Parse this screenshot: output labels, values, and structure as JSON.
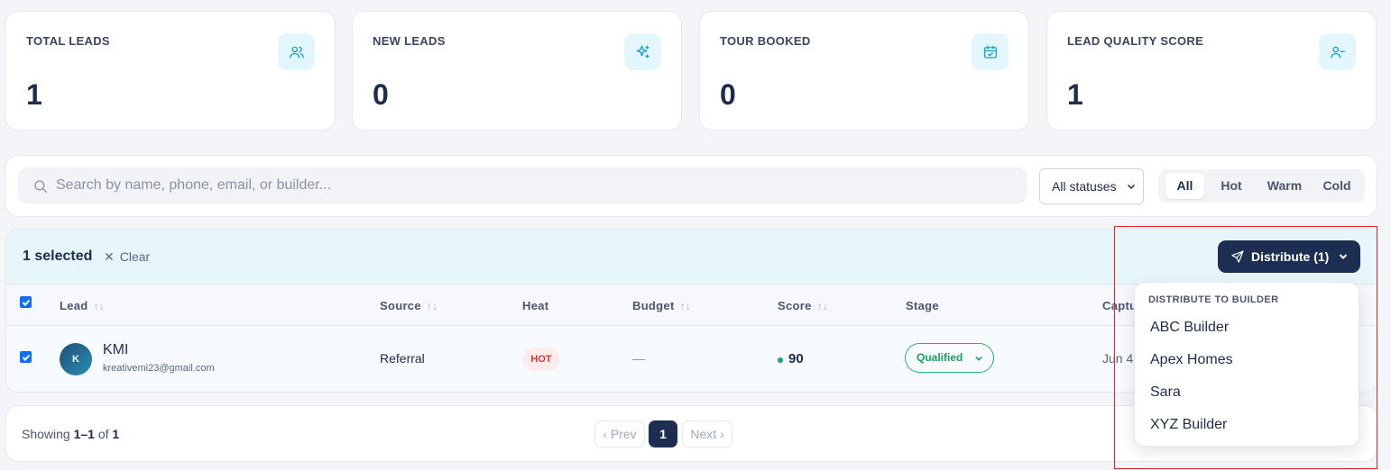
{
  "stats": [
    {
      "label": "TOTAL LEADS",
      "value": "1",
      "icon": "users-icon"
    },
    {
      "label": "NEW LEADS",
      "value": "0",
      "icon": "sparkles-icon"
    },
    {
      "label": "TOUR BOOKED",
      "value": "0",
      "icon": "calendar-check-icon"
    },
    {
      "label": "LEAD QUALITY SCORE",
      "value": "1",
      "icon": "user-minus-icon"
    }
  ],
  "filters": {
    "search_placeholder": "Search by name, phone, email, or builder...",
    "status_selected": "All statuses",
    "heat_tabs": [
      "All",
      "Hot",
      "Warm",
      "Cold"
    ],
    "heat_active": "All"
  },
  "selection": {
    "count_label": "1 selected",
    "clear_label": "Clear",
    "distribute_label": "Distribute (1)"
  },
  "table": {
    "columns": [
      "Lead",
      "Source",
      "Heat",
      "Budget",
      "Score",
      "Stage",
      "Captu"
    ],
    "rows": [
      {
        "avatar_initial": "K",
        "name": "KMI",
        "email": "kreativemi23@gmail.com",
        "source": "Referral",
        "heat": "HOT",
        "budget": "—",
        "score": "90",
        "stage": "Qualified",
        "captured": "Jun 4,"
      }
    ]
  },
  "pagination": {
    "showing_prefix": "Showing ",
    "range": "1–1",
    "of_word": " of ",
    "total": "1",
    "prev_label": "‹ Prev",
    "current_page": "1",
    "next_label": "Next ›"
  },
  "distribute_menu": {
    "header": "DISTRIBUTE TO BUILDER",
    "items": [
      "ABC Builder",
      "Apex Homes",
      "Sara",
      "XYZ Builder"
    ]
  },
  "colors": {
    "primary": "#1c2f52",
    "accent": "#17a2c8",
    "hot": "#d93636",
    "qualified": "#1a9e62",
    "highlight": "#e02424"
  }
}
